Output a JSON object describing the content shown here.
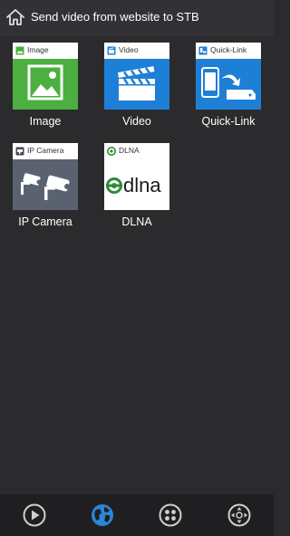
{
  "header": {
    "title": "Send video from website to STB",
    "home_icon": "home-icon"
  },
  "tiles": [
    {
      "id": "image",
      "head_label": "Image",
      "label": "Image",
      "color": "#4caf3f",
      "icon": "image-icon"
    },
    {
      "id": "video",
      "head_label": "Video",
      "label": "Video",
      "color": "#1e7fd6",
      "icon": "clapperboard-icon"
    },
    {
      "id": "quick-link",
      "head_label": "Quick-Link",
      "label": "Quick-Link",
      "color": "#1e7fd6",
      "icon": "phone-to-stb-icon"
    },
    {
      "id": "ip-camera",
      "head_label": "IP Camera",
      "label": "IP Camera",
      "color": "#5a6270",
      "icon": "cctv-camera-icon"
    },
    {
      "id": "dlna",
      "head_label": "DLNA",
      "label": "DLNA",
      "color": "#ffffff",
      "icon": "dlna-logo-icon",
      "logo_text": "dlna"
    }
  ],
  "bottom_nav": [
    {
      "id": "play",
      "icon": "play-icon",
      "active": false
    },
    {
      "id": "web",
      "icon": "globe-icon",
      "active": true
    },
    {
      "id": "apps",
      "icon": "grid-dots-icon",
      "active": false
    },
    {
      "id": "remote",
      "icon": "dpad-icon",
      "active": false
    }
  ],
  "colors": {
    "background": "#2b2b2e",
    "header": "#323236",
    "nav_bar": "#1f1f22",
    "nav_icon": "#cfcfcf",
    "nav_active": "#2a86d8"
  }
}
